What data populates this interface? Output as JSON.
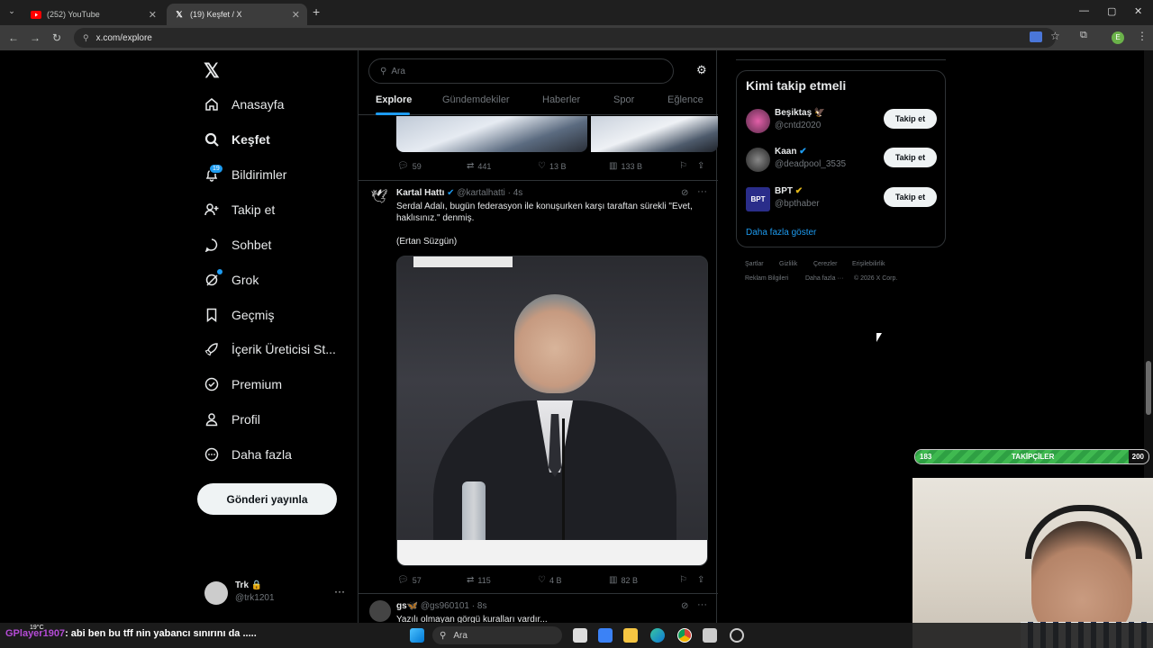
{
  "browser": {
    "tabs": [
      {
        "title": "(252) YouTube",
        "icon": "youtube-icon"
      },
      {
        "title": "(19) Keşfet / X",
        "icon": "x-logo-icon"
      }
    ],
    "url": "x.com/explore",
    "profile_initial": "E"
  },
  "sidebar": {
    "items": [
      {
        "label": "Anasayfa",
        "icon": "home-icon"
      },
      {
        "label": "Keşfet",
        "icon": "search-icon"
      },
      {
        "label": "Bildirimler",
        "icon": "bell-icon"
      },
      {
        "label": "Takip et",
        "icon": "add-user-icon"
      },
      {
        "label": "Sohbet",
        "icon": "chat-icon"
      },
      {
        "label": "Grok",
        "icon": "grok-icon"
      },
      {
        "label": "Geçmiş",
        "icon": "bookmark-icon"
      },
      {
        "label": "İçerik Üreticisi St...",
        "icon": "rocket-icon"
      },
      {
        "label": "Premium",
        "icon": "verified-icon"
      },
      {
        "label": "Profil",
        "icon": "person-icon"
      },
      {
        "label": "Daha fazla",
        "icon": "more-circle-icon"
      }
    ],
    "notification_count": "19",
    "post_button": "Gönderi yayınla",
    "account": {
      "name": "Trk",
      "handle": "@trk1201"
    }
  },
  "search": {
    "placeholder": "Ara"
  },
  "explore_tabs": [
    "Explore",
    "Gündemdekiler",
    "Haberler",
    "Spor",
    "Eğlence"
  ],
  "tweets": [
    {
      "stats": {
        "replies": "59",
        "reposts": "441",
        "likes": "13 B",
        "views": "133 B"
      }
    },
    {
      "name": "Kartal Hattı",
      "handle": "@kartalhatti",
      "time": "· 4s",
      "text_line1": "Serdal Adalı, bugün federasyon ile konuşurken karşı taraftan sürekli \"Evet,",
      "text_line2": "haklısınız.\" denmiş.",
      "text_line3": "(Ertan Süzgün)",
      "stats": {
        "replies": "57",
        "reposts": "115",
        "likes": "4 B",
        "views": "82 B"
      }
    },
    {
      "name": "gs🦋",
      "handle": "@gs960101",
      "time": "· 8s",
      "text_line1": "Yazılı olmayan görgü kuralları vardır..."
    }
  ],
  "who_to_follow": {
    "title": "Kimi takip etmeli",
    "accounts": [
      {
        "name": "Beşiktaş 🦅",
        "handle": "@cntd2020",
        "button": "Takip et"
      },
      {
        "name": "Kaan",
        "handle": "@deadpool_3535",
        "button": "Takip et"
      },
      {
        "name": "BPT",
        "handle": "@bpthaber",
        "button": "Takip et"
      }
    ],
    "show_more": "Daha fazla göster"
  },
  "footer": {
    "links_row1": [
      "Şartlar",
      "Gizlilik",
      "Çerezler",
      "Erişilebilirlik"
    ],
    "links_row2": [
      "Reklam Bilgileri",
      "Daha fazla ···",
      "© 2026 X Corp."
    ]
  },
  "overlay": {
    "follower_goal_current": "183",
    "follower_goal_label": "TAKİPÇİLER",
    "follower_goal_target": "200",
    "follower_goal_progress": 0.915,
    "chat_user": "GPlayer1907",
    "chat_message": ": abi ben bu tff nin yabancı sınırını da ....."
  },
  "taskbar": {
    "search_label": "Ara",
    "weather": "19°C"
  },
  "colors": {
    "accent": "#1d9bf0",
    "background": "#000000",
    "text": "#e7e9ea",
    "muted": "#71767b",
    "border": "#2f3336"
  }
}
